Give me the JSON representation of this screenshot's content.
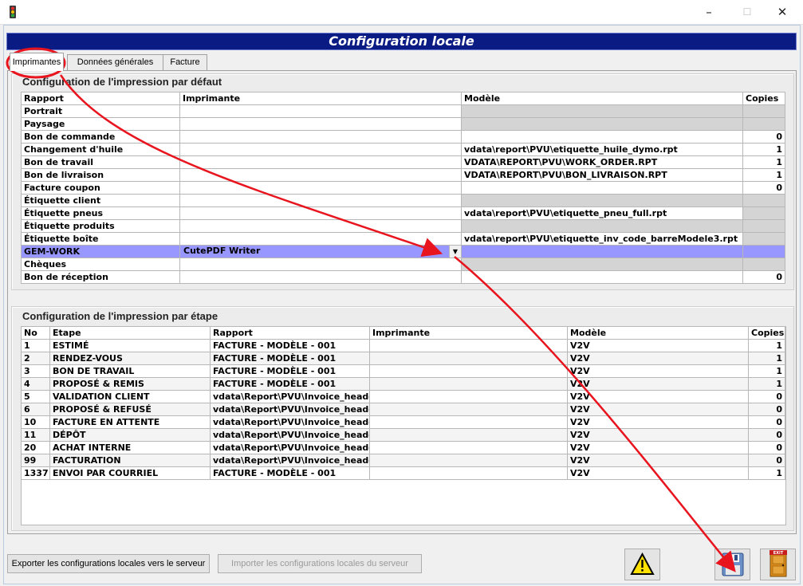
{
  "window": {
    "title": "",
    "minimize_glyph": "–",
    "maximize_glyph": "☐",
    "close_glyph": "✕"
  },
  "banner": {
    "title": "Configuration locale"
  },
  "tabs": [
    {
      "label": "Imprimantes",
      "active": true
    },
    {
      "label": "Données générales",
      "active": false
    },
    {
      "label": "Facture",
      "active": false
    }
  ],
  "default_print": {
    "title": "Configuration de l'impression par défaut",
    "columns": [
      "Rapport",
      "Imprimante",
      "Modèle",
      "Copies"
    ],
    "rows": [
      {
        "rapport": "Portrait",
        "imprimante": "",
        "modele": "",
        "copies": "",
        "gray": true
      },
      {
        "rapport": "Paysage",
        "imprimante": "",
        "modele": "",
        "copies": "",
        "gray": true
      },
      {
        "rapport": "Bon de commande",
        "imprimante": "",
        "modele": "",
        "copies": "0",
        "gray": false
      },
      {
        "rapport": "Changement d'huile",
        "imprimante": "",
        "modele": "vdata\\report\\PVU\\etiquette_huile_dymo.rpt",
        "copies": "1",
        "gray": false
      },
      {
        "rapport": "Bon de travail",
        "imprimante": "",
        "modele": "VDATA\\REPORT\\PVU\\WORK_ORDER.RPT",
        "copies": "1",
        "gray": false
      },
      {
        "rapport": "Bon de livraison",
        "imprimante": "",
        "modele": "VDATA\\REPORT\\PVU\\BON_LIVRAISON.RPT",
        "copies": "1",
        "gray": false
      },
      {
        "rapport": "Facture coupon",
        "imprimante": "",
        "modele": "",
        "copies": "0",
        "gray": false
      },
      {
        "rapport": "Étiquette client",
        "imprimante": "",
        "modele": "",
        "copies": "",
        "gray": true
      },
      {
        "rapport": "Étiquette pneus",
        "imprimante": "",
        "modele": "vdata\\report\\PVU\\etiquette_pneu_full.rpt",
        "copies": "",
        "gray": "copies"
      },
      {
        "rapport": "Étiquette produits",
        "imprimante": "",
        "modele": "",
        "copies": "",
        "gray": true
      },
      {
        "rapport": "Étiquette boîte",
        "imprimante": "",
        "modele": "vdata\\report\\PVU\\etiquette_inv_code_barreModele3.rpt",
        "copies": "",
        "gray": "copies"
      },
      {
        "rapport": "GEM-WORK",
        "imprimante": "CutePDF Writer",
        "modele": "",
        "copies": "",
        "selected": true
      },
      {
        "rapport": "Chèques",
        "imprimante": "",
        "modele": "",
        "copies": "",
        "gray": true
      },
      {
        "rapport": "Bon de réception",
        "imprimante": "",
        "modele": "",
        "copies": "0",
        "gray": false
      }
    ]
  },
  "step_print": {
    "title": "Configuration de l'impression par étape",
    "columns": [
      "No",
      "Etape",
      "Rapport",
      "Imprimante",
      "Modèle",
      "Copies"
    ],
    "rows": [
      {
        "no": "1",
        "etape": "ESTIMÉ",
        "rapport": "FACTURE - MODÈLE - 001",
        "imprimante": "",
        "modele": "V2V",
        "copies": "1"
      },
      {
        "no": "2",
        "etape": "RENDEZ-VOUS",
        "rapport": "FACTURE - MODÈLE - 001",
        "imprimante": "",
        "modele": "V2V",
        "copies": "1"
      },
      {
        "no": "3",
        "etape": "BON DE TRAVAIL",
        "rapport": "FACTURE - MODÈLE - 001",
        "imprimante": "",
        "modele": "V2V",
        "copies": "1"
      },
      {
        "no": "4",
        "etape": "PROPOSÉ & REMIS",
        "rapport": "FACTURE - MODÈLE - 001",
        "imprimante": "",
        "modele": "V2V",
        "copies": "1"
      },
      {
        "no": "5",
        "etape": "VALIDATION CLIENT",
        "rapport": "vdata\\Report\\PVU\\Invoice_heade",
        "imprimante": "",
        "modele": "V2V",
        "copies": "0"
      },
      {
        "no": "6",
        "etape": "PROPOSÉ & REFUSÉ",
        "rapport": "vdata\\Report\\PVU\\Invoice_heade",
        "imprimante": "",
        "modele": "V2V",
        "copies": "0"
      },
      {
        "no": "10",
        "etape": "FACTURE EN ATTENTE",
        "rapport": "vdata\\Report\\PVU\\Invoice_heade",
        "imprimante": "",
        "modele": "V2V",
        "copies": "0"
      },
      {
        "no": "11",
        "etape": "DÉPÔT",
        "rapport": "vdata\\Report\\PVU\\Invoice_heade",
        "imprimante": "",
        "modele": "V2V",
        "copies": "0"
      },
      {
        "no": "20",
        "etape": "ACHAT INTERNE",
        "rapport": "vdata\\Report\\PVU\\Invoice_heade",
        "imprimante": "",
        "modele": "V2V",
        "copies": "0"
      },
      {
        "no": "99",
        "etape": "FACTURATION",
        "rapport": "vdata\\Report\\PVU\\Invoice_heade",
        "imprimante": "",
        "modele": "V2V",
        "copies": "0"
      },
      {
        "no": "1337",
        "etape": "ENVOI PAR COURRIEL",
        "rapport": "FACTURE - MODÈLE - 001",
        "imprimante": "",
        "modele": "V2V",
        "copies": "1"
      }
    ]
  },
  "footer": {
    "export_label": "Exporter les configurations locales vers le serveur",
    "import_label": "Importer les configurations locales du serveur",
    "warning_icon": "warning-icon",
    "save_icon": "floppy-disk-icon",
    "exit_icon": "exit-door-icon",
    "exit_text": "EXIT"
  },
  "colors": {
    "banner": "#0a1c84",
    "selected_row": "#9797ff",
    "annotation": "#e8141e"
  }
}
